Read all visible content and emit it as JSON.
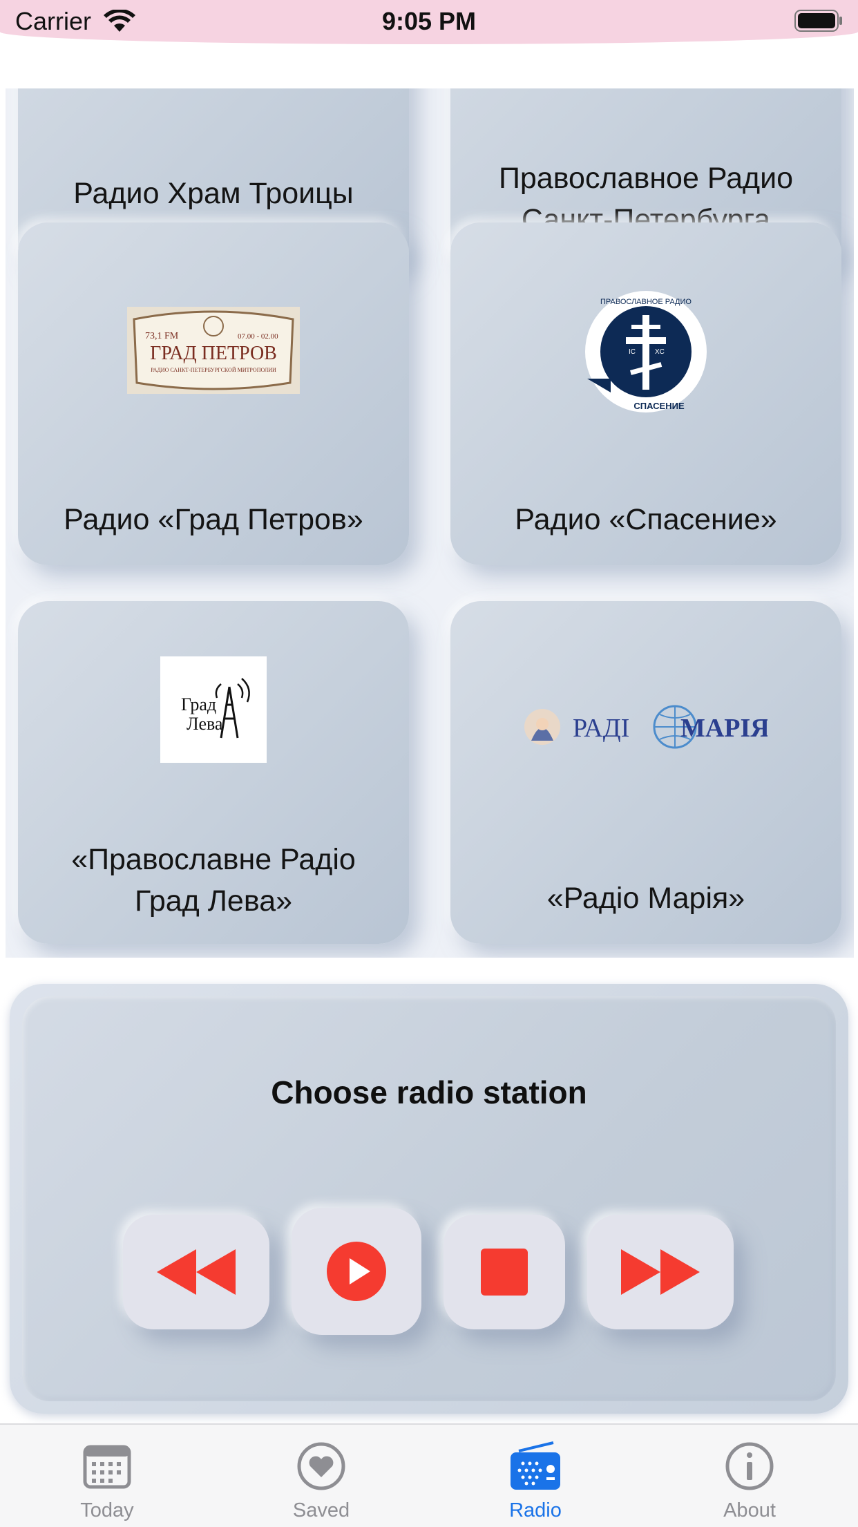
{
  "status_bar": {
    "carrier": "Carrier",
    "time": "9:05 PM"
  },
  "stations": [
    {
      "label": "Радио Храм Троицы",
      "logo": "none"
    },
    {
      "label": "Православное Радио\nСанкт-Петербурга",
      "logo": "none"
    },
    {
      "label": "Радио «Град Петров»",
      "logo": "grad-petrov-logo"
    },
    {
      "label": "Радио «Спасение»",
      "logo": "spasenie-logo"
    },
    {
      "label": "«Православне Радіо\nГрад Лева»",
      "logo": "grad-leva-logo"
    },
    {
      "label": "«Радіо Марія»",
      "logo": "radio-maria-logo"
    }
  ],
  "logos": {
    "grad_petrov": {
      "freq": "73,1 FM",
      "hours": "07.00 - 02.00",
      "name": "ГРАД ПЕТРОВ",
      "subtitle": "РАДИО САНКТ-ПЕТЕРБУРГСКОЙ МИТРОПОЛИИ"
    },
    "spasenie": {
      "top": "ПРАВОСЛАВНОЕ РАДИО",
      "bottom": "СПАСЕНИЕ",
      "left_mark": "IC",
      "right_mark": "XC"
    },
    "grad_leva": {
      "line1": "Град",
      "line2": "Лева"
    },
    "radio_maria": {
      "word1": "РАДІ",
      "word2": "МАРІЯ"
    }
  },
  "player": {
    "title": "Choose radio station",
    "controls": [
      "rewind",
      "play",
      "stop",
      "fast-forward"
    ],
    "accent_color": "#f53b30"
  },
  "tabs": [
    {
      "label": "Today",
      "icon": "calendar-icon",
      "active": false
    },
    {
      "label": "Saved",
      "icon": "heart-icon",
      "active": false
    },
    {
      "label": "Radio",
      "icon": "radio-icon",
      "active": true
    },
    {
      "label": "About",
      "icon": "info-icon",
      "active": false
    }
  ],
  "colors": {
    "active_tab": "#1a73e8",
    "inactive_tab": "#8e8e93",
    "status_bar": "#f6d3e1"
  }
}
